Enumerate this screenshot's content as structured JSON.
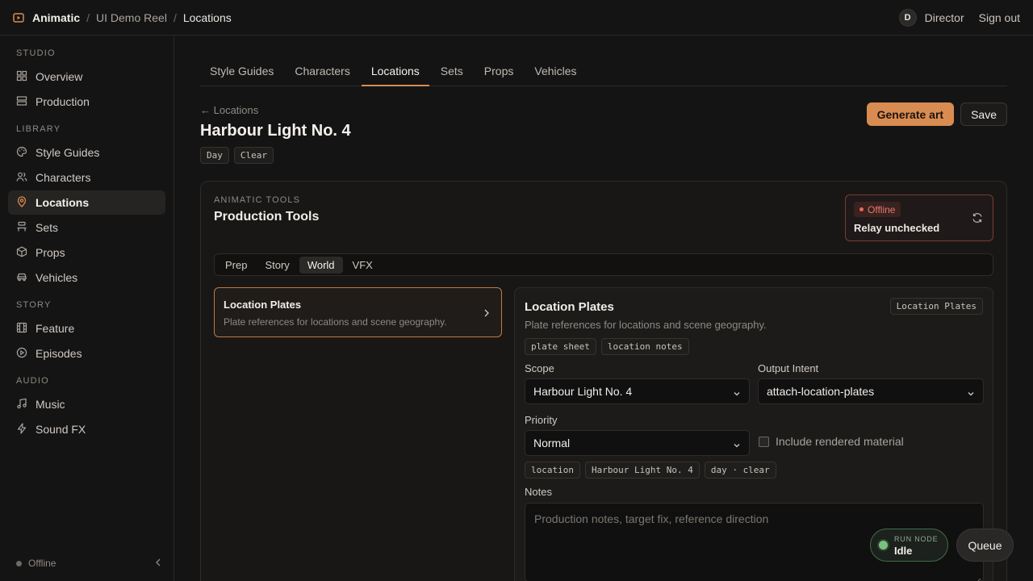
{
  "breadcrumb": {
    "app": "Animatic",
    "project": "UI Demo Reel",
    "current": "Locations"
  },
  "user": {
    "initial": "D",
    "role": "Director",
    "signout": "Sign out"
  },
  "sidebar": {
    "sections": [
      {
        "title": "STUDIO",
        "items": [
          {
            "label": "Overview",
            "icon": "grid-icon"
          },
          {
            "label": "Production",
            "icon": "layers-icon"
          }
        ]
      },
      {
        "title": "LIBRARY",
        "items": [
          {
            "label": "Style Guides",
            "icon": "palette-icon"
          },
          {
            "label": "Characters",
            "icon": "users-icon"
          },
          {
            "label": "Locations",
            "icon": "map-pin-icon",
            "active": true
          },
          {
            "label": "Sets",
            "icon": "set-icon"
          },
          {
            "label": "Props",
            "icon": "box-icon"
          },
          {
            "label": "Vehicles",
            "icon": "car-icon"
          }
        ]
      },
      {
        "title": "STORY",
        "items": [
          {
            "label": "Feature",
            "icon": "film-icon"
          },
          {
            "label": "Episodes",
            "icon": "play-circle-icon"
          }
        ]
      },
      {
        "title": "AUDIO",
        "items": [
          {
            "label": "Music",
            "icon": "music-icon"
          },
          {
            "label": "Sound FX",
            "icon": "bolt-icon"
          }
        ]
      }
    ],
    "status": "Offline"
  },
  "tabs": [
    "Style Guides",
    "Characters",
    "Locations",
    "Sets",
    "Props",
    "Vehicles"
  ],
  "active_tab": "Locations",
  "page": {
    "back": "← Locations",
    "title": "Harbour Light No. 4",
    "chips": [
      "Day",
      "Clear"
    ],
    "generate": "Generate art",
    "save": "Save"
  },
  "panel": {
    "eyebrow": "ANIMATIC TOOLS",
    "title": "Production Tools",
    "relay": {
      "badge": "Offline",
      "text": "Relay unchecked"
    },
    "segments": [
      "Prep",
      "Story",
      "World",
      "VFX"
    ],
    "active_segment": "World",
    "card": {
      "title": "Location Plates",
      "desc": "Plate references for locations and scene geography."
    },
    "detail": {
      "title": "Location Plates",
      "desc": "Plate references for locations and scene geography.",
      "tag": "Location Plates",
      "tags": [
        "plate sheet",
        "location notes"
      ],
      "scope_label": "Scope",
      "scope_value": "Harbour Light No. 4",
      "output_label": "Output Intent",
      "output_value": "attach-location-plates",
      "priority_label": "Priority",
      "priority_value": "Normal",
      "include_label": "Include rendered material",
      "context_tags": [
        "location",
        "Harbour Light No. 4",
        "day · clear"
      ],
      "notes_label": "Notes",
      "notes_placeholder": "Production notes, target fix, reference direction"
    }
  },
  "runnode": {
    "label": "RUN NODE",
    "value": "Idle"
  },
  "queue": "Queue",
  "colors": {
    "accent": "#d98c52",
    "offline": "#e8675a",
    "idle": "#78c17e"
  }
}
